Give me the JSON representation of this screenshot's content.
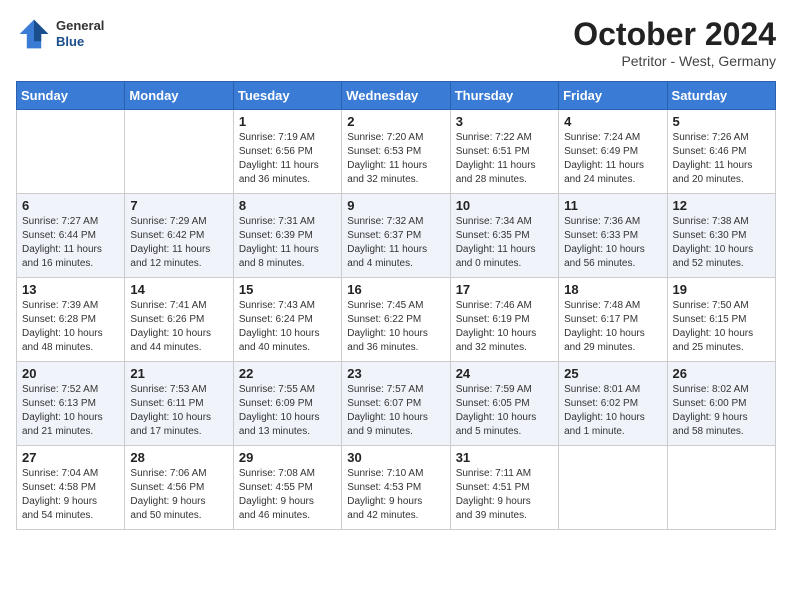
{
  "header": {
    "logo_line1": "General",
    "logo_line2": "Blue",
    "month": "October 2024",
    "location": "Petritor - West, Germany"
  },
  "days_of_week": [
    "Sunday",
    "Monday",
    "Tuesday",
    "Wednesday",
    "Thursday",
    "Friday",
    "Saturday"
  ],
  "weeks": [
    [
      {
        "day": "",
        "info": ""
      },
      {
        "day": "",
        "info": ""
      },
      {
        "day": "1",
        "info": "Sunrise: 7:19 AM\nSunset: 6:56 PM\nDaylight: 11 hours\nand 36 minutes."
      },
      {
        "day": "2",
        "info": "Sunrise: 7:20 AM\nSunset: 6:53 PM\nDaylight: 11 hours\nand 32 minutes."
      },
      {
        "day": "3",
        "info": "Sunrise: 7:22 AM\nSunset: 6:51 PM\nDaylight: 11 hours\nand 28 minutes."
      },
      {
        "day": "4",
        "info": "Sunrise: 7:24 AM\nSunset: 6:49 PM\nDaylight: 11 hours\nand 24 minutes."
      },
      {
        "day": "5",
        "info": "Sunrise: 7:26 AM\nSunset: 6:46 PM\nDaylight: 11 hours\nand 20 minutes."
      }
    ],
    [
      {
        "day": "6",
        "info": "Sunrise: 7:27 AM\nSunset: 6:44 PM\nDaylight: 11 hours\nand 16 minutes."
      },
      {
        "day": "7",
        "info": "Sunrise: 7:29 AM\nSunset: 6:42 PM\nDaylight: 11 hours\nand 12 minutes."
      },
      {
        "day": "8",
        "info": "Sunrise: 7:31 AM\nSunset: 6:39 PM\nDaylight: 11 hours\nand 8 minutes."
      },
      {
        "day": "9",
        "info": "Sunrise: 7:32 AM\nSunset: 6:37 PM\nDaylight: 11 hours\nand 4 minutes."
      },
      {
        "day": "10",
        "info": "Sunrise: 7:34 AM\nSunset: 6:35 PM\nDaylight: 11 hours\nand 0 minutes."
      },
      {
        "day": "11",
        "info": "Sunrise: 7:36 AM\nSunset: 6:33 PM\nDaylight: 10 hours\nand 56 minutes."
      },
      {
        "day": "12",
        "info": "Sunrise: 7:38 AM\nSunset: 6:30 PM\nDaylight: 10 hours\nand 52 minutes."
      }
    ],
    [
      {
        "day": "13",
        "info": "Sunrise: 7:39 AM\nSunset: 6:28 PM\nDaylight: 10 hours\nand 48 minutes."
      },
      {
        "day": "14",
        "info": "Sunrise: 7:41 AM\nSunset: 6:26 PM\nDaylight: 10 hours\nand 44 minutes."
      },
      {
        "day": "15",
        "info": "Sunrise: 7:43 AM\nSunset: 6:24 PM\nDaylight: 10 hours\nand 40 minutes."
      },
      {
        "day": "16",
        "info": "Sunrise: 7:45 AM\nSunset: 6:22 PM\nDaylight: 10 hours\nand 36 minutes."
      },
      {
        "day": "17",
        "info": "Sunrise: 7:46 AM\nSunset: 6:19 PM\nDaylight: 10 hours\nand 32 minutes."
      },
      {
        "day": "18",
        "info": "Sunrise: 7:48 AM\nSunset: 6:17 PM\nDaylight: 10 hours\nand 29 minutes."
      },
      {
        "day": "19",
        "info": "Sunrise: 7:50 AM\nSunset: 6:15 PM\nDaylight: 10 hours\nand 25 minutes."
      }
    ],
    [
      {
        "day": "20",
        "info": "Sunrise: 7:52 AM\nSunset: 6:13 PM\nDaylight: 10 hours\nand 21 minutes."
      },
      {
        "day": "21",
        "info": "Sunrise: 7:53 AM\nSunset: 6:11 PM\nDaylight: 10 hours\nand 17 minutes."
      },
      {
        "day": "22",
        "info": "Sunrise: 7:55 AM\nSunset: 6:09 PM\nDaylight: 10 hours\nand 13 minutes."
      },
      {
        "day": "23",
        "info": "Sunrise: 7:57 AM\nSunset: 6:07 PM\nDaylight: 10 hours\nand 9 minutes."
      },
      {
        "day": "24",
        "info": "Sunrise: 7:59 AM\nSunset: 6:05 PM\nDaylight: 10 hours\nand 5 minutes."
      },
      {
        "day": "25",
        "info": "Sunrise: 8:01 AM\nSunset: 6:02 PM\nDaylight: 10 hours\nand 1 minute."
      },
      {
        "day": "26",
        "info": "Sunrise: 8:02 AM\nSunset: 6:00 PM\nDaylight: 9 hours\nand 58 minutes."
      }
    ],
    [
      {
        "day": "27",
        "info": "Sunrise: 7:04 AM\nSunset: 4:58 PM\nDaylight: 9 hours\nand 54 minutes."
      },
      {
        "day": "28",
        "info": "Sunrise: 7:06 AM\nSunset: 4:56 PM\nDaylight: 9 hours\nand 50 minutes."
      },
      {
        "day": "29",
        "info": "Sunrise: 7:08 AM\nSunset: 4:55 PM\nDaylight: 9 hours\nand 46 minutes."
      },
      {
        "day": "30",
        "info": "Sunrise: 7:10 AM\nSunset: 4:53 PM\nDaylight: 9 hours\nand 42 minutes."
      },
      {
        "day": "31",
        "info": "Sunrise: 7:11 AM\nSunset: 4:51 PM\nDaylight: 9 hours\nand 39 minutes."
      },
      {
        "day": "",
        "info": ""
      },
      {
        "day": "",
        "info": ""
      }
    ]
  ]
}
